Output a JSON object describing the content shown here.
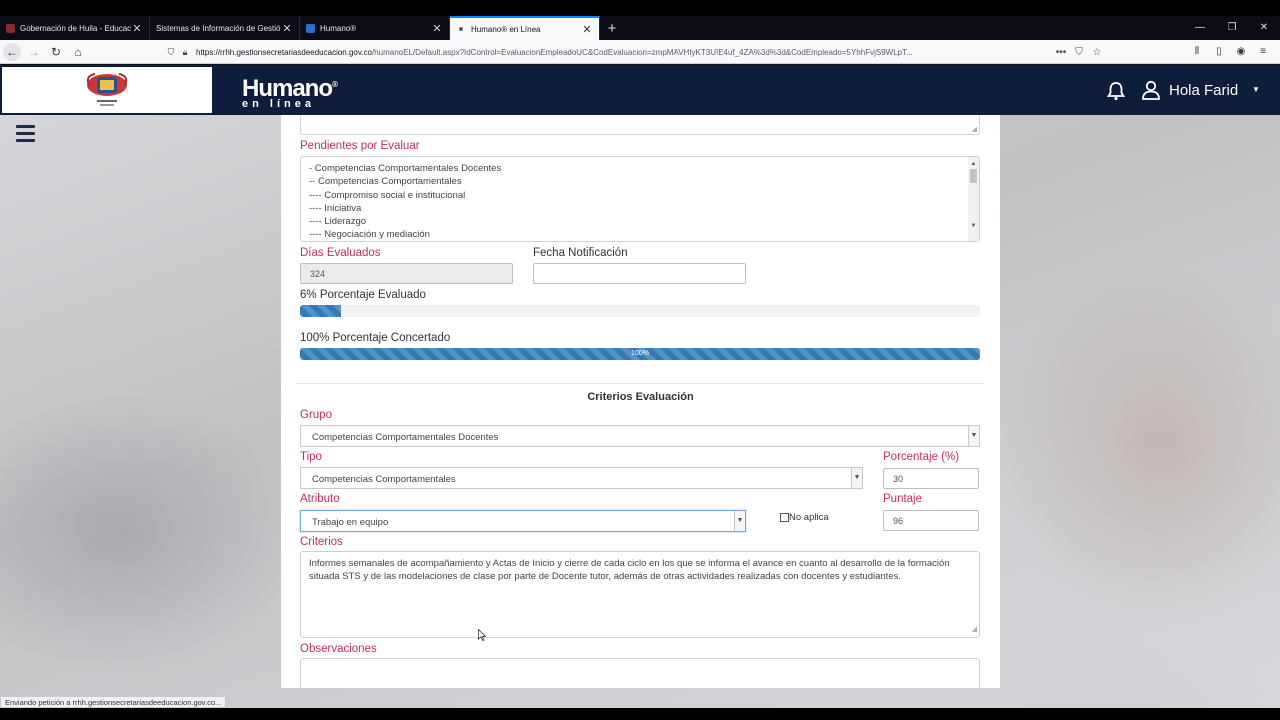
{
  "browser": {
    "tabs": [
      {
        "title": "Gobernación de Huila - Educac",
        "favicon_color": "#8a2b2b"
      },
      {
        "title": "Sistemas de Información de Gestió",
        "favicon_color": "#3a3a55"
      },
      {
        "title": "Humano®",
        "favicon_color": "#2a6fc9"
      },
      {
        "title": "Humano® en Línea",
        "favicon_color": "#2a6fc9"
      }
    ],
    "url_host": "https://rrhh.gestionsecretariasdeeducacion.gov.co",
    "url_path": "/humanoEL/Default.aspx?IdControl=EvaluacionEmpleadoUC&CodEvaluacion=zmpMAVHtyKT3UIE4uf_4ZA%3d%3d&CodEmpleado=5YhhFvjS9WLpT...",
    "status_text": "Enviando petición a rrhh.gestionsecretariasdeeducacion.gov.co..."
  },
  "header": {
    "logo_caption": "Gobernación del Huila",
    "brand_name": "Humano",
    "brand_mark": "®",
    "brand_sub": "en línea",
    "greeting": "Hola Farid",
    "accent_color": "#0e1d3c"
  },
  "form": {
    "pendientes_label": "Pendientes por Evaluar",
    "pendientes": [
      "- Competencias Comportamentales Docentes",
      "-- Competencias Comportamentales",
      "---- Compromiso social e institucional",
      "---- Iniciativa",
      "---- Liderazgo",
      "---- Negociación y mediación"
    ],
    "dias_label": "Días Evaluados",
    "dias_value": "324",
    "fecha_label": "Fecha Notificación",
    "fecha_value": "",
    "evaluado_label": "6% Porcentaje Evaluado",
    "evaluado_pct": 6,
    "concertado_label": "100% Porcentaje Concertado",
    "concertado_pct": 100,
    "concertado_text": "100%",
    "section_title": "Criterios Evaluación",
    "grupo_label": "Grupo",
    "grupo_value": "Competencias Comportamentales Docentes",
    "tipo_label": "Tipo",
    "tipo_value": "Competencias Comportamentales",
    "porcentaje_label": "Porcentaje (%)",
    "porcentaje_value": "30",
    "atributo_label": "Atributo",
    "atributo_value": "Trabajo en equipo",
    "no_aplica_label": "No aplica",
    "puntaje_label": "Puntaje",
    "puntaje_value": "96",
    "criterios_label": "Criterios",
    "criterios_text": "Informes semanales de acompañamiento y Actas de Inicio y cierre de cada ciclo en los que se informa el avance en cuanto al desarrollo de la formación situada STS y de las modelaciones de clase por parte de Docente tutor, además de otras actividades realizadas con docentes y estudiantes.",
    "observaciones_label": "Observaciones",
    "label_color": "#c0315a",
    "progress_color": "#337ab7"
  }
}
